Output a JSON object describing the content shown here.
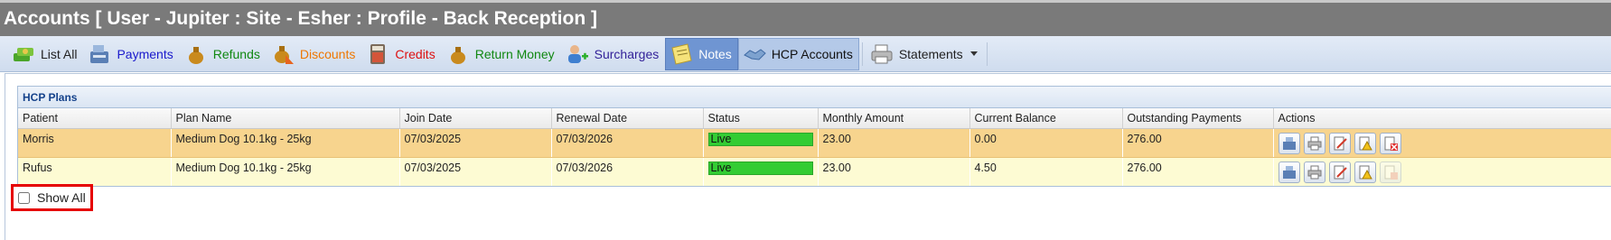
{
  "title": "Accounts [ User - Jupiter : Site - Esher : Profile - Back Reception ]",
  "toolbar": [
    {
      "label": "List All",
      "icon": "money-stack-icon",
      "color": "#222222"
    },
    {
      "label": "Payments",
      "icon": "cash-register-icon",
      "color": "#1a1acc"
    },
    {
      "label": "Refunds",
      "icon": "money-bag-icon",
      "color": "#118811"
    },
    {
      "label": "Discounts",
      "icon": "money-bag-discount-icon",
      "color": "#ee7700"
    },
    {
      "label": "Credits",
      "icon": "credit-calculator-icon",
      "color": "#dd1111"
    },
    {
      "label": "Return Money",
      "icon": "money-bag-return-icon",
      "color": "#118811"
    },
    {
      "label": "Surcharges",
      "icon": "user-add-icon",
      "color": "#332299"
    },
    {
      "label": "Notes",
      "icon": "notes-icon",
      "color": "#ffffff"
    },
    {
      "label": "HCP Accounts",
      "icon": "handshake-icon",
      "color": "#111111"
    },
    {
      "label": "Statements",
      "icon": "printer-icon",
      "color": "#222222"
    }
  ],
  "panel": {
    "title": "HCP Plans",
    "columns": [
      "Patient",
      "Plan Name",
      "Join Date",
      "Renewal Date",
      "Status",
      "Monthly Amount",
      "Current Balance",
      "Outstanding Payments",
      "Actions"
    ],
    "rows": [
      {
        "patient": "Morris",
        "plan": "Medium Dog 10.1kg - 25kg",
        "join": "07/03/2025",
        "renewal": "07/03/2026",
        "status": "Live",
        "monthly": "23.00",
        "balance": "0.00",
        "outstanding": "276.00"
      },
      {
        "patient": "Rufus",
        "plan": "Medium Dog 10.1kg - 25kg",
        "join": "07/03/2025",
        "renewal": "07/03/2026",
        "status": "Live",
        "monthly": "23.00",
        "balance": "4.50",
        "outstanding": "276.00"
      }
    ]
  },
  "show_all": {
    "label": "Show All",
    "checked": false
  },
  "colors": {
    "title_bg": "#7a7a7a",
    "selected_row": "#f7d48e",
    "alt_row": "#fdfbd3",
    "status_live": "#33cc33",
    "highlight": "#e60000"
  }
}
